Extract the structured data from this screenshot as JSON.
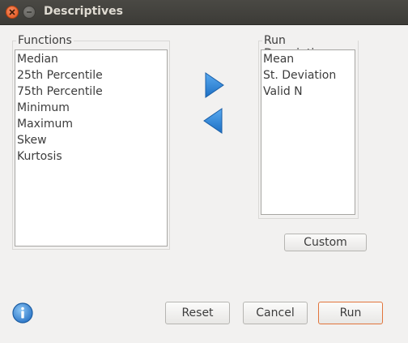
{
  "window": {
    "title": "Descriptives"
  },
  "functions": {
    "label": "Functions",
    "items": [
      "Median",
      "25th Percentile",
      "75th Percentile",
      "Minimum",
      "Maximum",
      "Skew",
      "Kurtosis"
    ]
  },
  "run_descriptives": {
    "label": "Run Descriptives",
    "items": [
      "Mean",
      "St. Deviation",
      "Valid N"
    ]
  },
  "buttons": {
    "custom": "Custom",
    "reset": "Reset",
    "cancel": "Cancel",
    "run": "Run"
  },
  "icons": {
    "add": "arrow-right-icon",
    "remove": "arrow-left-icon",
    "info": "info-icon"
  },
  "colors": {
    "arrow_blue": "#2f86d8",
    "default_button_border": "#e2753c",
    "close_button": "#e2531c"
  }
}
